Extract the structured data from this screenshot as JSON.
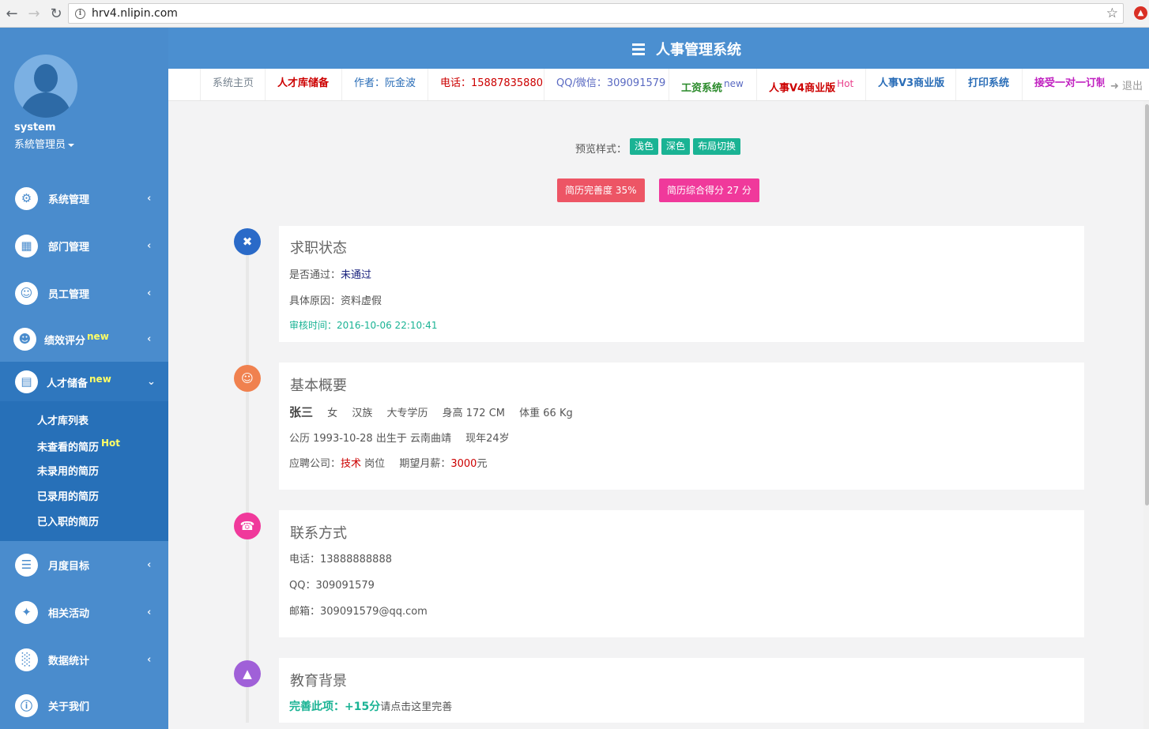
{
  "browser": {
    "url": "hrv4.nlipin.com"
  },
  "header": {
    "title": "人事管理系统"
  },
  "user": {
    "name": "system",
    "role": "系統管理员"
  },
  "sidebar": {
    "items": [
      {
        "label": "系统管理",
        "icon": "gear-icon"
      },
      {
        "label": "部门管理",
        "icon": "grid-icon"
      },
      {
        "label": "员工管理",
        "icon": "user-icon"
      },
      {
        "label": "绩效评分",
        "badge": "new",
        "icon": "smile-icon"
      },
      {
        "label": "人才储备",
        "badge": "new",
        "icon": "id-card-icon"
      },
      {
        "label": "月度目标",
        "icon": "list-icon"
      },
      {
        "label": "相关活动",
        "icon": "running-icon"
      },
      {
        "label": "数据统计",
        "icon": "bar-chart-icon"
      },
      {
        "label": "关于我们",
        "icon": "info-icon"
      }
    ],
    "submenu": [
      {
        "label": "人才库列表"
      },
      {
        "label": "未查看的简历",
        "badge": "Hot"
      },
      {
        "label": "未录用的简历"
      },
      {
        "label": "已录用的简历"
      },
      {
        "label": "已入职的简历"
      }
    ]
  },
  "tabs": [
    {
      "label": "系统主页"
    },
    {
      "label": "人才库储备"
    },
    {
      "label": "作者：阮金波"
    },
    {
      "label": "电话：15887835880"
    },
    {
      "label": "QQ/微信：309091579"
    },
    {
      "label": "工资系统",
      "badge": "new"
    },
    {
      "label": "人事V4商业版",
      "badge": "Hot"
    },
    {
      "label": "人事V3商业版"
    },
    {
      "label": "打印系统"
    },
    {
      "label": "接受一对一订制"
    }
  ],
  "logout": "退出",
  "preview": {
    "label": "预览样式：",
    "options": [
      "浅色",
      "深色",
      "布局切换"
    ]
  },
  "resume_badges": {
    "completeness": "简历完善度 35%",
    "score": "简历综合得分 27 分"
  },
  "status_card": {
    "title": "求职状态",
    "passed_label": "是否通过：",
    "passed_value": "未通过",
    "reason_label": "具体原因：",
    "reason_value": "资料虚假",
    "review_time": "审核时间：2016-10-06 22:10:41"
  },
  "profile_card": {
    "title": "基本概要",
    "name": "张三",
    "gender": "女",
    "ethnicity": "汉族",
    "education": "大专学历",
    "height": "身高 172 CM",
    "weight": "体重 66 Kg",
    "birth": "公历 1993-10-28 出生于 云南曲靖",
    "age": "现年24岁",
    "apply_label": "应聘公司：",
    "apply_position": "技术",
    "position_suffix": "岗位",
    "salary_label": "期望月薪：",
    "salary_value": "3000",
    "salary_unit": "元"
  },
  "contact_card": {
    "title": "联系方式",
    "phone": "电话：13888888888",
    "qq": "QQ：309091579",
    "email": "邮箱：309091579@qq.com"
  },
  "education_card": {
    "title": "教育背景",
    "bonus": "完善此项：+15分",
    "hint": "请点击这里完善"
  },
  "colors": {
    "sidebar": "#4a8ccd",
    "topbar": "#4b8fd0",
    "green": "#1ab394",
    "red": "#ed5565",
    "pink": "#f0399b"
  }
}
